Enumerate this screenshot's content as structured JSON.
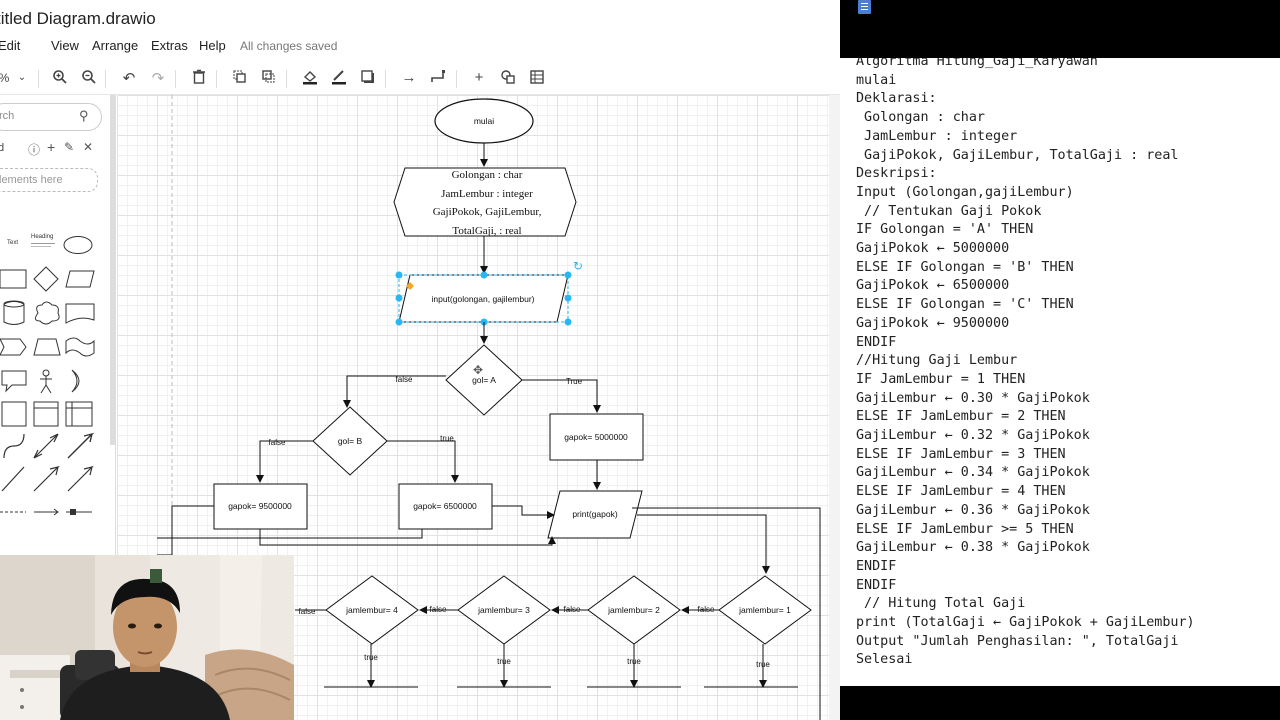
{
  "app": {
    "title": "titled Diagram.drawio",
    "menu": [
      "Edit",
      "View",
      "Arrange",
      "Extras",
      "Help"
    ],
    "status": "All changes saved",
    "zoom": "%",
    "search_placeholder": "rch",
    "drop_hint": "lements here",
    "shape_labels": {
      "text": "Text",
      "heading": "Heading"
    }
  },
  "diagram": {
    "start": "mulai",
    "decl": [
      "Golongan : char",
      "JamLembur : integer",
      "GajiPokok, GajiLembur,",
      "TotalGaji,  : real"
    ],
    "input": "input(golongan, gajilembur)",
    "gol_a": "gol= A",
    "gol_b": "gol= B",
    "gapok_5": "gapok= 5000000",
    "gapok_95": "gapok= 9500000",
    "gapok_65": "gapok= 6500000",
    "print": "print(gapok)",
    "jam1": "jamlembur= 1",
    "jam2": "jamlembur= 2",
    "jam3": "jamlembur= 3",
    "jam4": "jamlembur= 4",
    "lbl_false": "false",
    "lbl_true": "true",
    "lbl_True": "True"
  },
  "code": [
    "Algoritma Hitung_Gaji_Karyawan",
    "mulai",
    "Deklarasi:",
    " Golongan : char",
    " JamLembur : integer",
    " GajiPokok, GajiLembur, TotalGaji : real",
    "Deskripsi:",
    "Input (Golongan,gajiLembur)",
    " // Tentukan Gaji Pokok",
    "IF Golongan = 'A' THEN",
    "GajiPokok ← 5000000",
    "ELSE IF Golongan = 'B' THEN",
    "GajiPokok ← 6500000",
    "ELSE IF Golongan = 'C' THEN",
    "GajiPokok ← 9500000",
    "ENDIF",
    "//Hitung Gaji Lembur",
    "IF JamLembur = 1 THEN",
    "GajiLembur ← 0.30 * GajiPokok",
    "ELSE IF JamLembur = 2 THEN",
    "GajiLembur ← 0.32 * GajiPokok",
    "ELSE IF JamLembur = 3 THEN",
    "GajiLembur ← 0.34 * GajiPokok",
    "ELSE IF JamLembur = 4 THEN",
    "GajiLembur ← 0.36 * GajiPokok",
    "ELSE IF JamLembur >= 5 THEN",
    "GajiLembur ← 0.38 * GajiPokok",
    "ENDIF",
    "ENDIF",
    " // Hitung Total Gaji",
    "print (TotalGaji ← GajiPokok + GajiLembur)",
    "Output \"Jumlah Penghasilan: \", TotalGaji",
    "Selesai"
  ]
}
